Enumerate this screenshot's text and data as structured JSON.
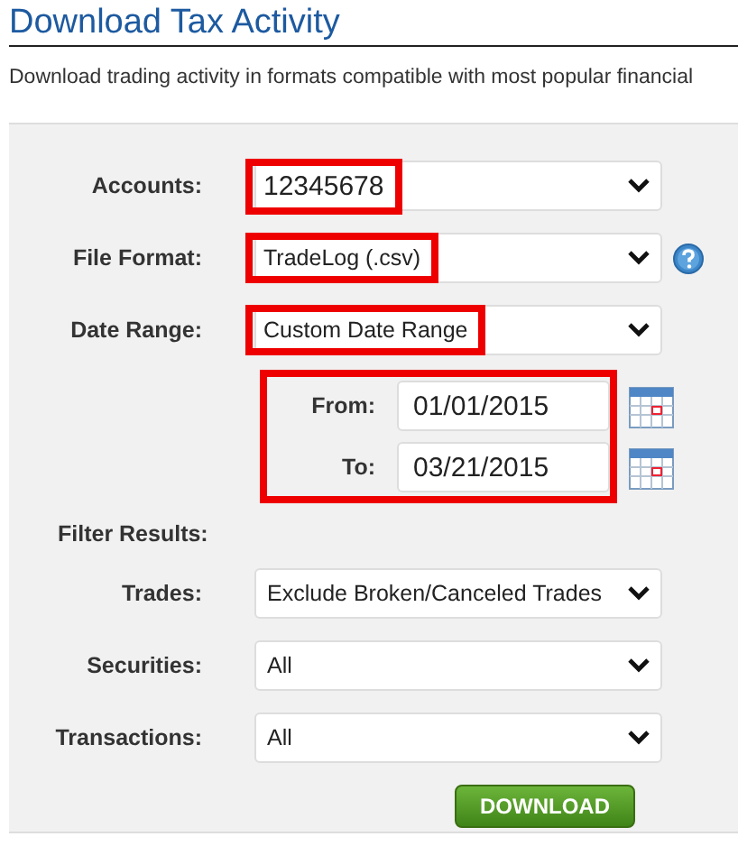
{
  "title": "Download Tax Activity",
  "description": "Download trading activity in formats compatible with most popular financial",
  "fields": [
    {
      "kind": "select",
      "label": "Accounts:",
      "value": "12345678",
      "highlighted": true
    },
    {
      "kind": "select",
      "label": "File Format:",
      "value": "TradeLog (.csv)",
      "highlighted": true,
      "help": true
    },
    {
      "kind": "select",
      "label": "Date Range:",
      "value": "Custom Date Range",
      "highlighted": true
    },
    {
      "kind": "dates",
      "highlighted": true,
      "dates": [
        {
          "label": "From:",
          "value": "01/01/2015"
        },
        {
          "label": "To:",
          "value": "03/21/2015"
        }
      ]
    },
    {
      "kind": "heading",
      "label": "Filter Results:"
    },
    {
      "kind": "select",
      "label": "Trades:",
      "value": "Exclude Broken/Canceled Trades",
      "highlighted": false
    },
    {
      "kind": "select",
      "label": "Securities:",
      "value": "All",
      "highlighted": false
    },
    {
      "kind": "select",
      "label": "Transactions:",
      "value": "All",
      "highlighted": false
    }
  ],
  "button": "DOWNLOAD"
}
